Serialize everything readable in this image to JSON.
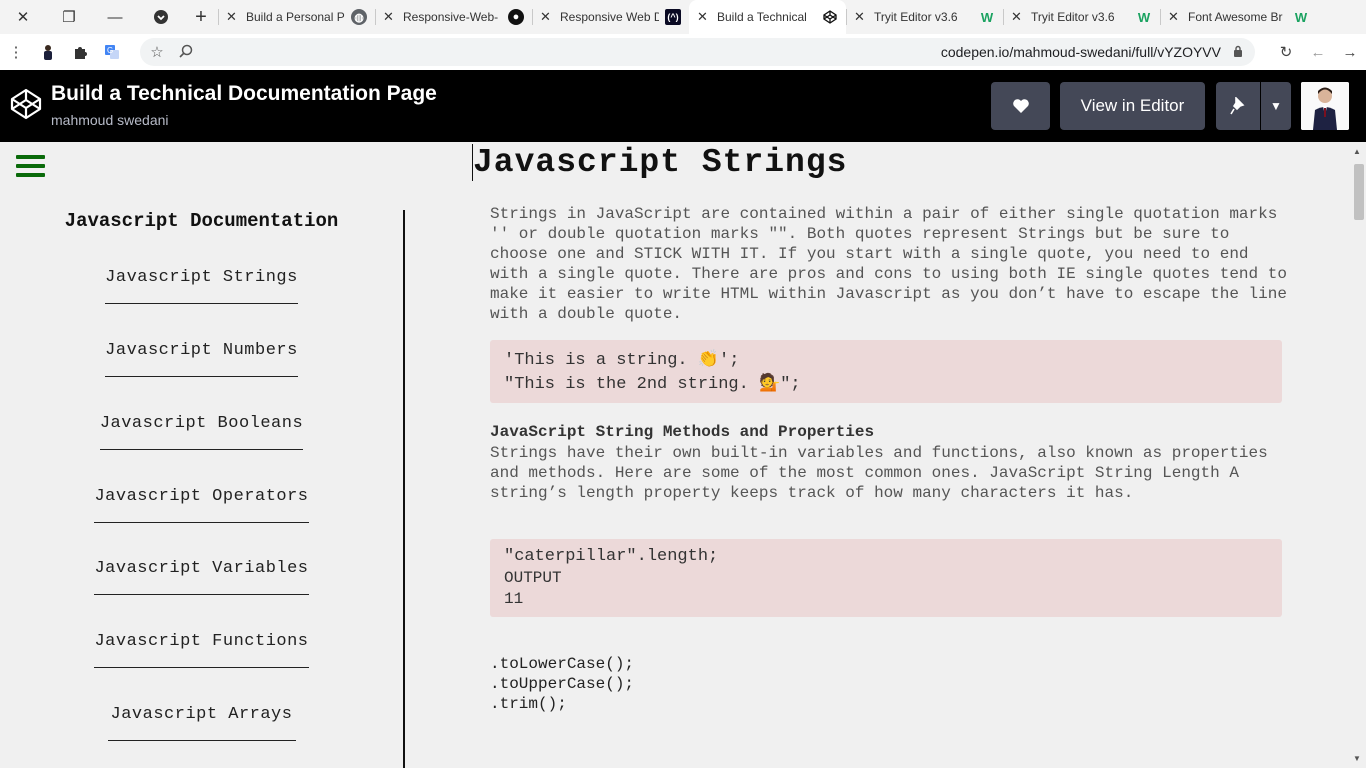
{
  "browser": {
    "window_controls": {
      "close": "✕",
      "restore": "❐",
      "minimize": "—"
    },
    "new_tab": "+",
    "tabs": [
      {
        "title": "Build a Personal P",
        "favicon": "globe-icon",
        "active": false
      },
      {
        "title": "Responsive-Web-",
        "favicon": "github-icon",
        "active": false
      },
      {
        "title": "Responsive Web D",
        "favicon": "freecodecamp-icon",
        "active": false
      },
      {
        "title": "Build a Technical",
        "favicon": "codepen-icon",
        "active": true
      },
      {
        "title": "Tryit Editor v3.6",
        "favicon": "w3schools-icon",
        "active": false
      },
      {
        "title": "Tryit Editor v3.6",
        "favicon": "w3schools-icon",
        "active": false
      },
      {
        "title": "Font Awesome Br",
        "favicon": "w3schools-icon",
        "active": false
      }
    ],
    "url": "codepen.io/mahmoud-swedani/full/vYZOYVV"
  },
  "codepen": {
    "title": "Build a Technical Documentation Page",
    "author": "mahmoud swedani",
    "view_in_editor": "View in Editor"
  },
  "sidebar": {
    "header": "Javascript Documentation",
    "items": [
      {
        "label": "Javascript Strings"
      },
      {
        "label": "Javascript Numbers"
      },
      {
        "label": "Javascript Booleans"
      },
      {
        "label": "Javascript Operators"
      },
      {
        "label": "Javascript Variables"
      },
      {
        "label": "Javascript Functions"
      },
      {
        "label": "Javascript Arrays"
      }
    ]
  },
  "main": {
    "heading": "Javascript Strings",
    "intro": "Strings in JavaScript are contained within a pair of either single quotation marks '' or double quotation marks \"\". Both quotes represent Strings but be sure to choose one and STICK WITH IT. If you start with a single quote, you need to end with a single quote. There are pros and cons to using both IE single quotes tend to make it easier to write HTML within Javascript as you don’t have to escape the line with a double quote.",
    "code1": [
      "'This is a string. 👏';",
      "\"This is the 2nd string. 💁\";"
    ],
    "subheading": "JavaScript String Methods and Properties",
    "para2": "Strings have their own built-in variables and functions, also known as properties and methods. Here are some of the most common ones. JavaScript String Length A string’s length property keeps track of how many characters it has.",
    "code2": [
      "\"caterpillar\".length;",
      "OUTPUT",
      "11"
    ],
    "methods": [
      ".toLowerCase();",
      ".toUpperCase();",
      ".trim();"
    ]
  }
}
